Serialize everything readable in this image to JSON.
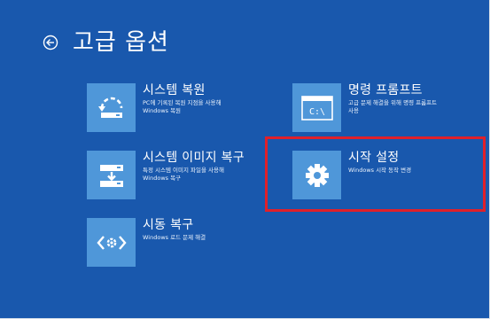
{
  "header": {
    "title": "고급 옵션"
  },
  "options": [
    {
      "id": "system-restore",
      "icon": "system-restore-icon",
      "title": "시스템 복원",
      "desc_lines": [
        "PC에 기록된 복원 지점을 사용해",
        "Windows 복원"
      ]
    },
    {
      "id": "image-recovery",
      "icon": "system-image-icon",
      "title": "시스템 이미지 복구",
      "desc_lines": [
        "특정 시스템 이미지 파일을 사용해",
        "Windows 복구"
      ]
    },
    {
      "id": "startup-repair",
      "icon": "startup-repair-icon",
      "title": "시동 복구",
      "desc_lines": [
        "Windows 로드 문제 해결"
      ]
    },
    {
      "id": "command-prompt",
      "icon": "command-prompt-icon",
      "title": "명령 프롬프트",
      "desc_lines": [
        "고급 문제 해결을 위해 명령 프롬프트",
        "사용"
      ],
      "icon_text": "C:\\"
    },
    {
      "id": "startup-settings",
      "icon": "gear-icon",
      "title": "시작 설정",
      "desc_lines": [
        "Windows 시작 동작 변경"
      ]
    }
  ],
  "colors": {
    "background": "#1958ad",
    "tile": "#4f97d9",
    "highlight": "#e0202a"
  }
}
